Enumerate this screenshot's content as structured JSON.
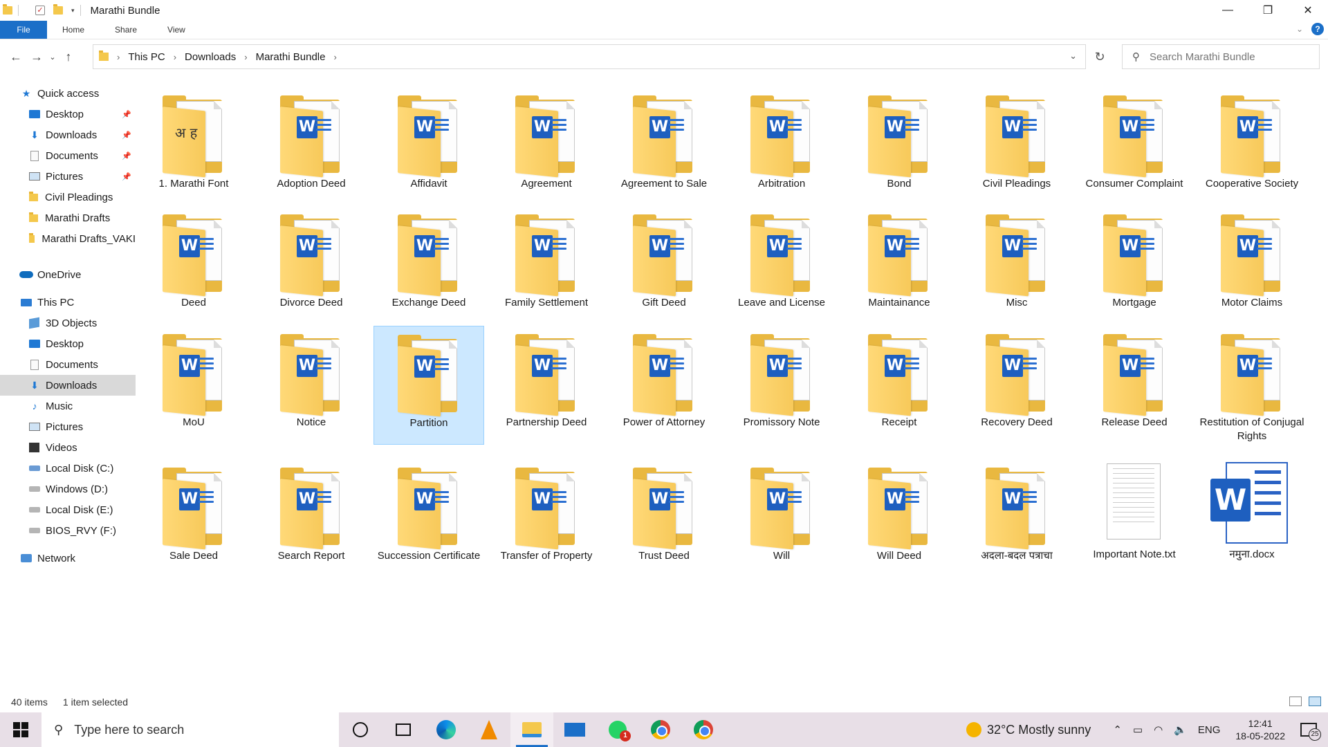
{
  "window": {
    "title": "Marathi Bundle",
    "controls": {
      "minimize": "—",
      "maximize": "❐",
      "close": "✕"
    }
  },
  "ribbon": {
    "tabs": [
      "File",
      "Home",
      "Share",
      "View"
    ],
    "help": "?"
  },
  "address_bar": {
    "crumbs": [
      "This PC",
      "Downloads",
      "Marathi Bundle"
    ],
    "search_placeholder": "Search Marathi Bundle"
  },
  "sidebar": {
    "quick_access": "Quick access",
    "quick_items": [
      {
        "label": "Desktop",
        "icon": "desktop-icon",
        "pinned": true
      },
      {
        "label": "Downloads",
        "icon": "download-icon",
        "pinned": true
      },
      {
        "label": "Documents",
        "icon": "documents-icon",
        "pinned": true
      },
      {
        "label": "Pictures",
        "icon": "pictures-icon",
        "pinned": true
      },
      {
        "label": "Civil Pleadings",
        "icon": "folder-icon",
        "pinned": false
      },
      {
        "label": "Marathi Drafts",
        "icon": "folder-icon",
        "pinned": false
      },
      {
        "label": "Marathi Drafts_VAKI",
        "icon": "folder-icon",
        "pinned": false
      }
    ],
    "onedrive": "OneDrive",
    "this_pc": "This PC",
    "pc_items": [
      {
        "label": "3D Objects",
        "icon": "3d-objects-icon"
      },
      {
        "label": "Desktop",
        "icon": "desktop-icon"
      },
      {
        "label": "Documents",
        "icon": "documents-icon"
      },
      {
        "label": "Downloads",
        "icon": "download-icon",
        "selected": true
      },
      {
        "label": "Music",
        "icon": "music-icon"
      },
      {
        "label": "Pictures",
        "icon": "pictures-icon"
      },
      {
        "label": "Videos",
        "icon": "videos-icon"
      },
      {
        "label": "Local Disk (C:)",
        "icon": "drive-icon"
      },
      {
        "label": "Windows (D:)",
        "icon": "drive-icon"
      },
      {
        "label": "Local Disk (E:)",
        "icon": "drive-icon"
      },
      {
        "label": "BIOS_RVY (F:)",
        "icon": "drive-icon"
      }
    ],
    "network": "Network"
  },
  "files": [
    {
      "name": "1. Marathi Font",
      "type": "folder-font"
    },
    {
      "name": "Adoption Deed",
      "type": "folder-word"
    },
    {
      "name": "Affidavit",
      "type": "folder-word"
    },
    {
      "name": "Agreement",
      "type": "folder-word"
    },
    {
      "name": "Agreement to Sale",
      "type": "folder-word"
    },
    {
      "name": "Arbitration",
      "type": "folder-word"
    },
    {
      "name": "Bond",
      "type": "folder-word"
    },
    {
      "name": "Civil Pleadings",
      "type": "folder-word"
    },
    {
      "name": "Consumer Complaint",
      "type": "folder-word"
    },
    {
      "name": "Cooperative Society",
      "type": "folder-word"
    },
    {
      "name": "Deed",
      "type": "folder-word"
    },
    {
      "name": "Divorce Deed",
      "type": "folder-word"
    },
    {
      "name": "Exchange Deed",
      "type": "folder-word"
    },
    {
      "name": "Family Settlement",
      "type": "folder-word"
    },
    {
      "name": "Gift Deed",
      "type": "folder-word"
    },
    {
      "name": "Leave and License",
      "type": "folder-word"
    },
    {
      "name": "Maintainance",
      "type": "folder-word"
    },
    {
      "name": "Misc",
      "type": "folder-word"
    },
    {
      "name": "Mortgage",
      "type": "folder-word"
    },
    {
      "name": "Motor Claims",
      "type": "folder-word"
    },
    {
      "name": "MoU",
      "type": "folder-word"
    },
    {
      "name": "Notice",
      "type": "folder-word"
    },
    {
      "name": "Partition",
      "type": "folder-word",
      "selected": true
    },
    {
      "name": "Partnership Deed",
      "type": "folder-word"
    },
    {
      "name": "Power of Attorney",
      "type": "folder-word"
    },
    {
      "name": "Promissory Note",
      "type": "folder-word"
    },
    {
      "name": "Receipt",
      "type": "folder-word"
    },
    {
      "name": "Recovery Deed",
      "type": "folder-word"
    },
    {
      "name": "Release Deed",
      "type": "folder-word"
    },
    {
      "name": "Restitution of Conjugal Rights",
      "type": "folder-word"
    },
    {
      "name": "Sale Deed",
      "type": "folder-word"
    },
    {
      "name": "Search Report",
      "type": "folder-word"
    },
    {
      "name": "Succession Certificate",
      "type": "folder-word"
    },
    {
      "name": "Transfer of Property",
      "type": "folder-word"
    },
    {
      "name": "Trust Deed",
      "type": "folder-word"
    },
    {
      "name": "Will",
      "type": "folder-word"
    },
    {
      "name": "Will Deed",
      "type": "folder-word"
    },
    {
      "name": "अदला-बदल पत्राचा",
      "type": "folder-word"
    },
    {
      "name": "Important Note.txt",
      "type": "txt"
    },
    {
      "name": "नमुना.docx",
      "type": "docx"
    }
  ],
  "status": {
    "count": "40 items",
    "selection": "1 item selected"
  },
  "taskbar": {
    "search_placeholder": "Type here to search",
    "whatsapp_badge": "1",
    "weather": "32°C  Mostly sunny",
    "language": "ENG",
    "time": "12:41",
    "date": "18-05-2022",
    "notifications": "25"
  },
  "colors": {
    "accent": "#1b6fc8",
    "selection": "#cce8ff",
    "folder": "#f4c84c"
  }
}
